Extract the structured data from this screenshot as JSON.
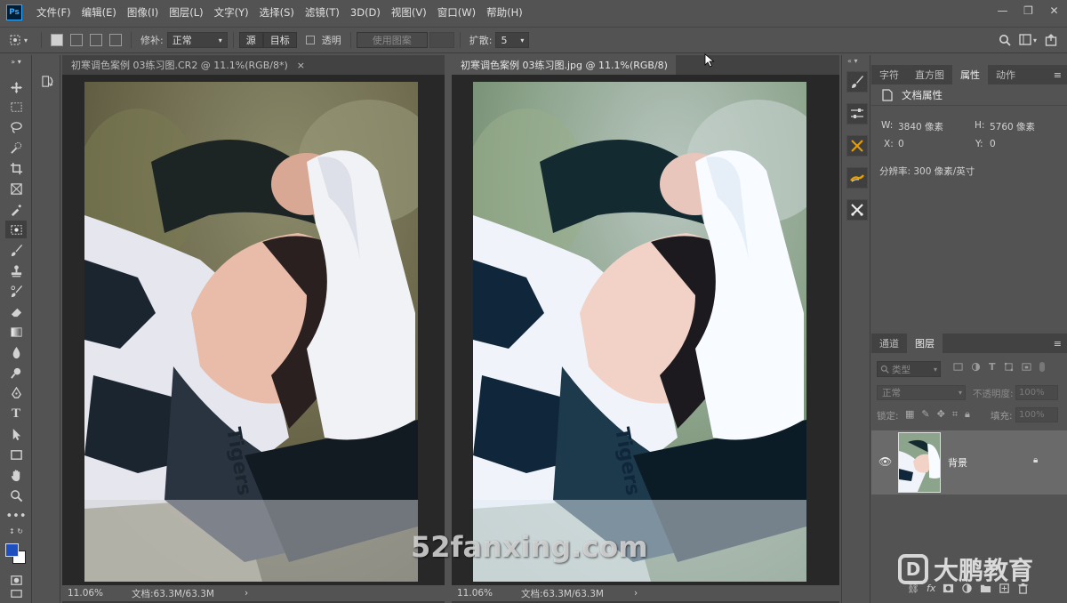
{
  "app": {
    "logo": "Ps"
  },
  "menu": [
    "文件(F)",
    "编辑(E)",
    "图像(I)",
    "图层(L)",
    "文字(Y)",
    "选择(S)",
    "滤镜(T)",
    "3D(D)",
    "视图(V)",
    "窗口(W)",
    "帮助(H)"
  ],
  "window_controls": {
    "minimize": "—",
    "restore": "❐",
    "close": "✕"
  },
  "options": {
    "patch_label": "修补:",
    "patch_mode": "正常",
    "source_btn": "源",
    "target_btn": "目标",
    "transparent_label": "透明",
    "use_pattern_btn": "使用图案",
    "diffuse_label": "扩散:",
    "diffuse_value": "5"
  },
  "documents": [
    {
      "tab": "初寒调色案例 03练习图.CR2 @ 11.1%(RGB/8*)",
      "close": "×",
      "zoom": "11.06%",
      "doc_info": "文档:63.3M/63.3M",
      "arrow": "›"
    },
    {
      "tab": "初寒调色案例 03练习图.jpg @ 11.1%(RGB/8)",
      "close": "×",
      "zoom": "11.06%",
      "doc_info": "文档:63.3M/63.3M",
      "arrow": "›"
    }
  ],
  "properties_panel": {
    "tabs": [
      "字符",
      "直方图",
      "属性",
      "动作"
    ],
    "active_tab": "属性",
    "title": "文档属性",
    "w_label": "W:",
    "w_value": "3840 像素",
    "h_label": "H:",
    "h_value": "5760 像素",
    "x_label": "X:",
    "x_value": "0",
    "y_label": "Y:",
    "y_value": "0",
    "resolution": "分辨率: 300 像素/英寸"
  },
  "layers_panel": {
    "tabs": [
      "通道",
      "图层"
    ],
    "active_tab": "图层",
    "filter_label": "类型",
    "blend_mode": "正常",
    "opacity_label": "不透明度:",
    "opacity_value": "100%",
    "lock_label": "锁定:",
    "fill_label": "填充:",
    "fill_value": "100%",
    "layer_name": "背景"
  },
  "watermark": "52fanxing.com",
  "brand": {
    "logo": "D",
    "name": "大鹏教育"
  },
  "colors": {
    "foreground": "#1f4fbf",
    "background": "#ffffff",
    "active_tool_bg": "#3f3f3f"
  }
}
